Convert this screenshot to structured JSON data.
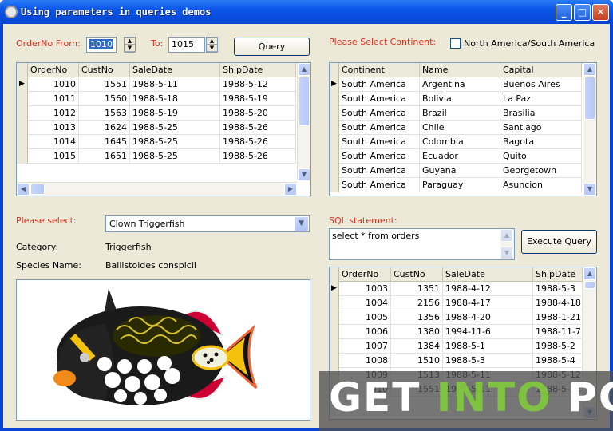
{
  "window": {
    "title": "Using parameters in queries demos"
  },
  "orderno": {
    "from_label": "OrderNo From:",
    "from_value": "1010",
    "to_label": "To:",
    "to_value": "1015",
    "query_label": "Query"
  },
  "orders_grid": {
    "columns": [
      "OrderNo",
      "CustNo",
      "SaleDate",
      "ShipDate"
    ],
    "rows": [
      [
        "1010",
        "1551",
        "1988-5-11",
        "1988-5-12"
      ],
      [
        "1011",
        "1560",
        "1988-5-18",
        "1988-5-19"
      ],
      [
        "1012",
        "1563",
        "1988-5-19",
        "1988-5-20"
      ],
      [
        "1013",
        "1624",
        "1988-5-25",
        "1988-5-26"
      ],
      [
        "1014",
        "1645",
        "1988-5-25",
        "1988-5-26"
      ],
      [
        "1015",
        "1651",
        "1988-5-25",
        "1988-5-26"
      ]
    ]
  },
  "continent": {
    "label": "Please Select Continent:",
    "checkbox_label": "North America/South America"
  },
  "countries_grid": {
    "columns": [
      "Continent",
      "Name",
      "Capital"
    ],
    "rows": [
      [
        "South America",
        "Argentina",
        "Buenos Aires"
      ],
      [
        "South America",
        "Bolivia",
        "La Paz"
      ],
      [
        "South America",
        "Brazil",
        "Brasilia"
      ],
      [
        "South America",
        "Chile",
        "Santiago"
      ],
      [
        "South America",
        "Colombia",
        "Bagota"
      ],
      [
        "South America",
        "Ecuador",
        "Quito"
      ],
      [
        "South America",
        "Guyana",
        "Georgetown"
      ],
      [
        "South America",
        "Paraguay",
        "Asuncion"
      ]
    ]
  },
  "fish": {
    "select_label": "Please select:",
    "selected": "Clown Triggerfish",
    "category_label": "Category:",
    "category_value": "Triggerfish",
    "species_label": "Species Name:",
    "species_value": "Ballistoides conspicil"
  },
  "sql": {
    "label": "SQL statement:",
    "text": "select * from orders",
    "execute_label": "Execute Query"
  },
  "results_grid": {
    "columns": [
      "OrderNo",
      "CustNo",
      "SaleDate",
      "ShipDate"
    ],
    "rows": [
      [
        "1003",
        "1351",
        "1988-4-12",
        "1988-5-3"
      ],
      [
        "1004",
        "2156",
        "1988-4-17",
        "1988-4-18"
      ],
      [
        "1005",
        "1356",
        "1988-4-20",
        "1988-1-21"
      ],
      [
        "1006",
        "1380",
        "1994-11-6",
        "1988-11-7"
      ],
      [
        "1007",
        "1384",
        "1988-5-1",
        "1988-5-2"
      ],
      [
        "1008",
        "1510",
        "1988-5-3",
        "1988-5-4"
      ],
      [
        "1009",
        "1513",
        "1988-5-11",
        "1988-5-12"
      ],
      [
        "1010",
        "1551",
        "1988-5-11",
        "1988-5-12"
      ]
    ]
  },
  "watermark": {
    "part1": "GET ",
    "part2": "INTO",
    "part3": " PC"
  }
}
